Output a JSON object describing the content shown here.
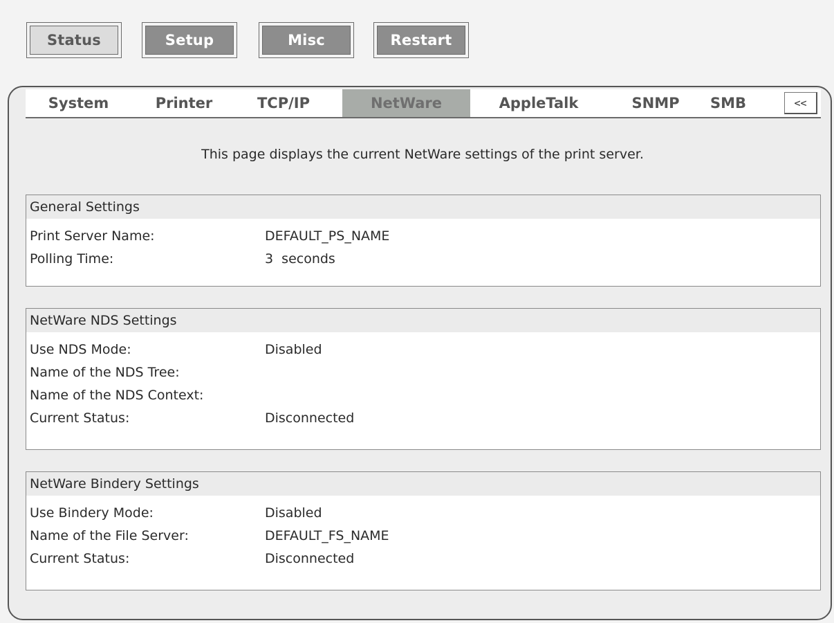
{
  "top_nav": {
    "buttons": [
      {
        "label": "Status",
        "state": "active"
      },
      {
        "label": "Setup",
        "state": "inactive"
      },
      {
        "label": "Misc",
        "state": "inactive"
      },
      {
        "label": "Restart",
        "state": "inactive"
      }
    ]
  },
  "tabs": {
    "items": [
      {
        "label": "System"
      },
      {
        "label": "Printer"
      },
      {
        "label": "TCP/IP"
      },
      {
        "label": "NetWare",
        "selected": true
      },
      {
        "label": "AppleTalk"
      },
      {
        "label": "SNMP"
      },
      {
        "label": "SMB"
      }
    ],
    "scroll_button": "<<"
  },
  "description": "This page displays the current NetWare settings of the print server.",
  "sections": {
    "general": {
      "title": "General Settings",
      "rows": [
        {
          "label": "Print Server Name:",
          "value": "DEFAULT_PS_NAME"
        },
        {
          "label": "Polling Time:",
          "value": "3  seconds"
        }
      ]
    },
    "nds": {
      "title": "NetWare NDS Settings",
      "rows": [
        {
          "label": "Use NDS Mode:",
          "value": "Disabled"
        },
        {
          "label": "Name of the NDS Tree:",
          "value": ""
        },
        {
          "label": "Name of the NDS Context:",
          "value": ""
        },
        {
          "label": "Current Status:",
          "value": "Disconnected"
        }
      ]
    },
    "bindery": {
      "title": "NetWare Bindery Settings",
      "rows": [
        {
          "label": "Use Bindery Mode:",
          "value": "Disabled"
        },
        {
          "label": "Name of the File Server:",
          "value": "DEFAULT_FS_NAME"
        },
        {
          "label": "Current Status:",
          "value": "Disconnected"
        }
      ]
    }
  },
  "colors": {
    "page_background": "#f3f3f3",
    "panel_background": "#ededed",
    "active_button_fill": "#dcdcdc",
    "inactive_button_fill": "#8d8d8d",
    "selected_tab_fill": "#a8aca8",
    "section_header_fill": "#ebebeb",
    "border": "#6a6a6a"
  }
}
